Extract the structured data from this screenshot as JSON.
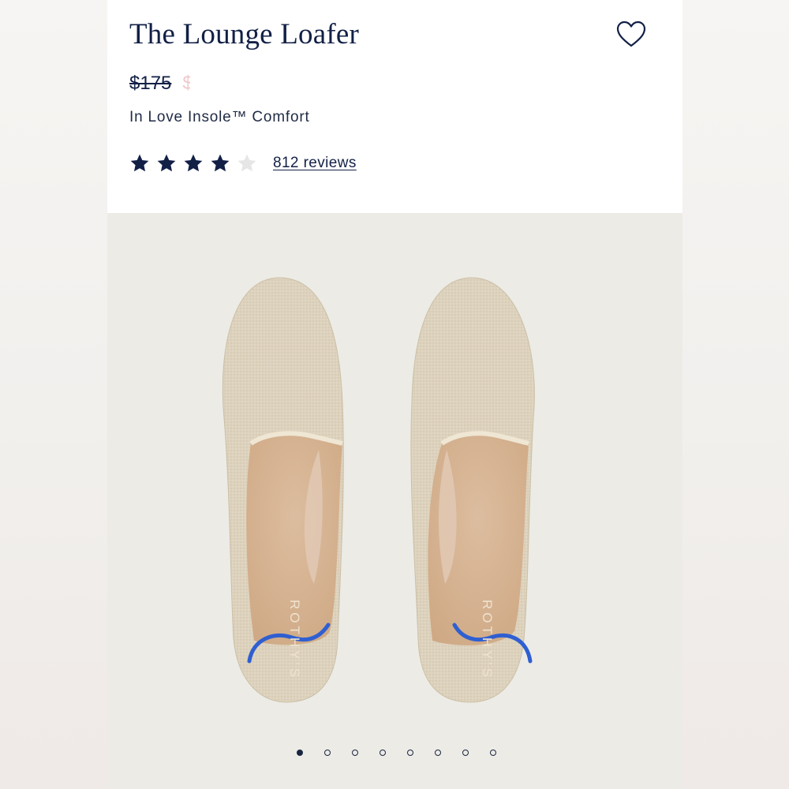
{
  "product": {
    "title": "The Lounge Loafer",
    "price_original": "$175",
    "price_sale": "$",
    "feature": "In Love Insole™ Comfort",
    "rating": 4,
    "rating_max": 5,
    "reviews_label": "812 reviews",
    "brand_mark": "ROTHY'S"
  },
  "carousel": {
    "count": 8,
    "active_index": 0
  },
  "icons": {
    "favorite": "heart-outline-icon",
    "star": "star-icon"
  },
  "colors": {
    "navy": "#122046",
    "star_empty": "#e6e6e6",
    "shoe_knit": "#ddd2bd",
    "insole": "#d9b99a",
    "heel_stripe": "#2f5fd1",
    "image_bg": "#ecebe6"
  }
}
